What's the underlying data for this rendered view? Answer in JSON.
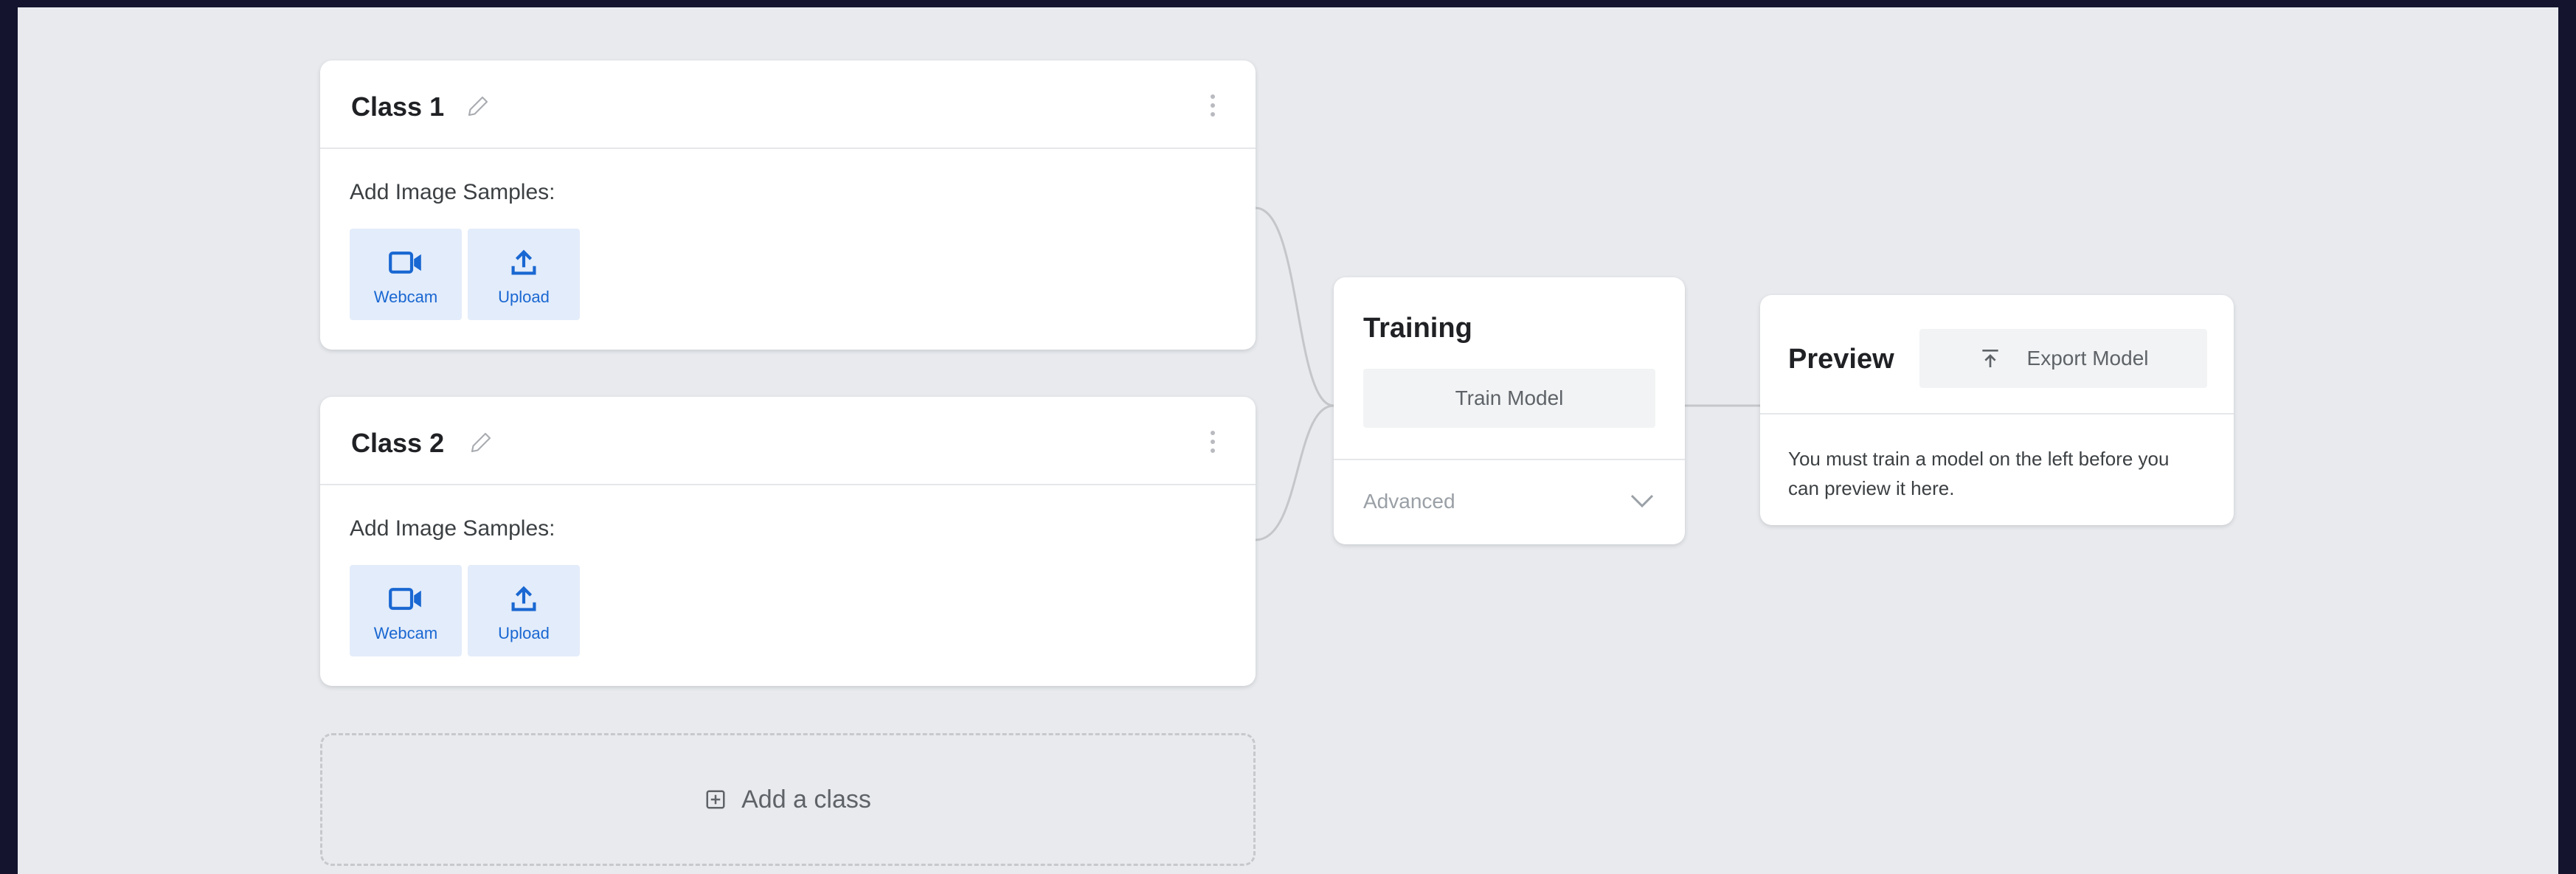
{
  "classes": [
    {
      "title": "Class 1",
      "samples_label": "Add Image Samples:",
      "webcam_label": "Webcam",
      "upload_label": "Upload"
    },
    {
      "title": "Class 2",
      "samples_label": "Add Image Samples:",
      "webcam_label": "Webcam",
      "upload_label": "Upload"
    }
  ],
  "add_class": {
    "label": "Add a class"
  },
  "training": {
    "title": "Training",
    "train_button": "Train Model",
    "advanced_label": "Advanced"
  },
  "preview": {
    "title": "Preview",
    "export_button": "Export Model",
    "message": "You must train a model on the left before you can preview it here."
  },
  "colors": {
    "background": "#e8eaee",
    "accent_blue": "#1967d2",
    "button_blue_bg": "#e3ecfa"
  },
  "icons": {
    "edit": "pencil-icon",
    "menu": "kebab-menu-icon",
    "webcam": "video-camera-icon",
    "upload": "upload-arrow-icon",
    "add": "plus-box-icon",
    "expand": "chevron-down-icon",
    "export": "export-icon"
  }
}
